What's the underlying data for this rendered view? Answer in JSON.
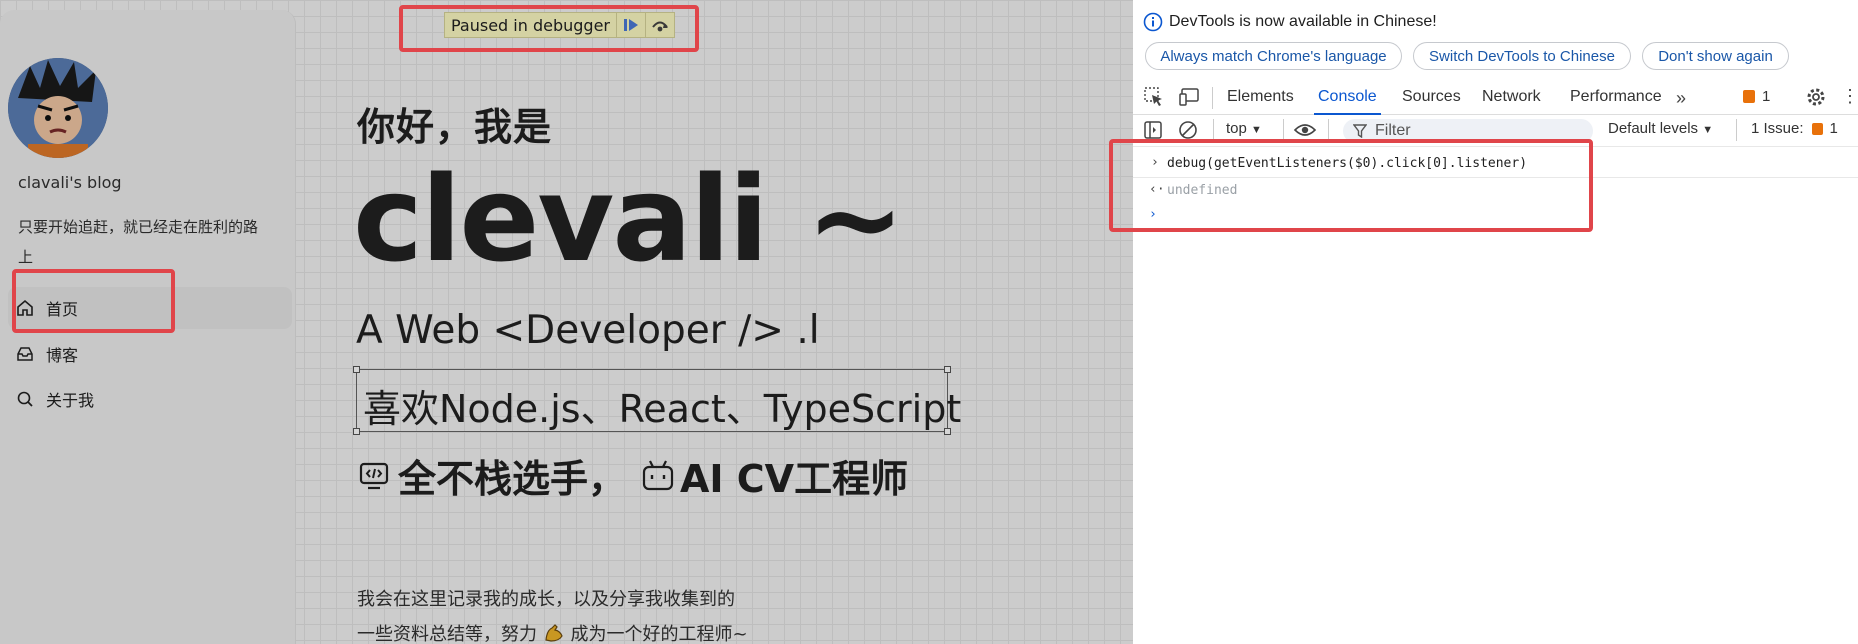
{
  "page": {
    "paused_banner": "Paused in debugger",
    "blog_name": "clavali's blog",
    "motto": "只要开始追赶，就已经走在胜利的路上",
    "nav": [
      {
        "label": "首页",
        "icon": "home-icon"
      },
      {
        "label": "博客",
        "icon": "inbox-icon"
      },
      {
        "label": "关于我",
        "icon": "search-icon"
      }
    ],
    "hero": {
      "greeting": "你好，我是",
      "name": "clevali ~",
      "subtitle": "A Web <Developer /> .l",
      "likes": "喜欢Node.js、React、TypeScript",
      "stack_part1": "全不栈选手，",
      "stack_part2": "AI CV工程师"
    },
    "intro_line1": "我会在这里记录我的成长，以及分享我收集到的",
    "intro_line2a": "一些资料总结等，努力",
    "intro_line2b": "成为一个好的工程师~",
    "highlight_color": "#e0454a"
  },
  "devtools": {
    "info_text": "DevTools is now available in Chinese!",
    "buttons": [
      "Always match Chrome's language",
      "Switch DevTools to Chinese",
      "Don't show again"
    ],
    "tabs": [
      "Elements",
      "Console",
      "Sources",
      "Network",
      "Performance"
    ],
    "active_tab": "Console",
    "tab_issue_count": "1",
    "context": "top",
    "filter_placeholder": "Filter",
    "levels": "Default levels",
    "issues_label": "1 Issue:",
    "issues_count": "1",
    "console_input": "debug(getEventListeners($0).click[0].listener)",
    "console_output": "undefined",
    "accent_color": "#0b57d0"
  }
}
